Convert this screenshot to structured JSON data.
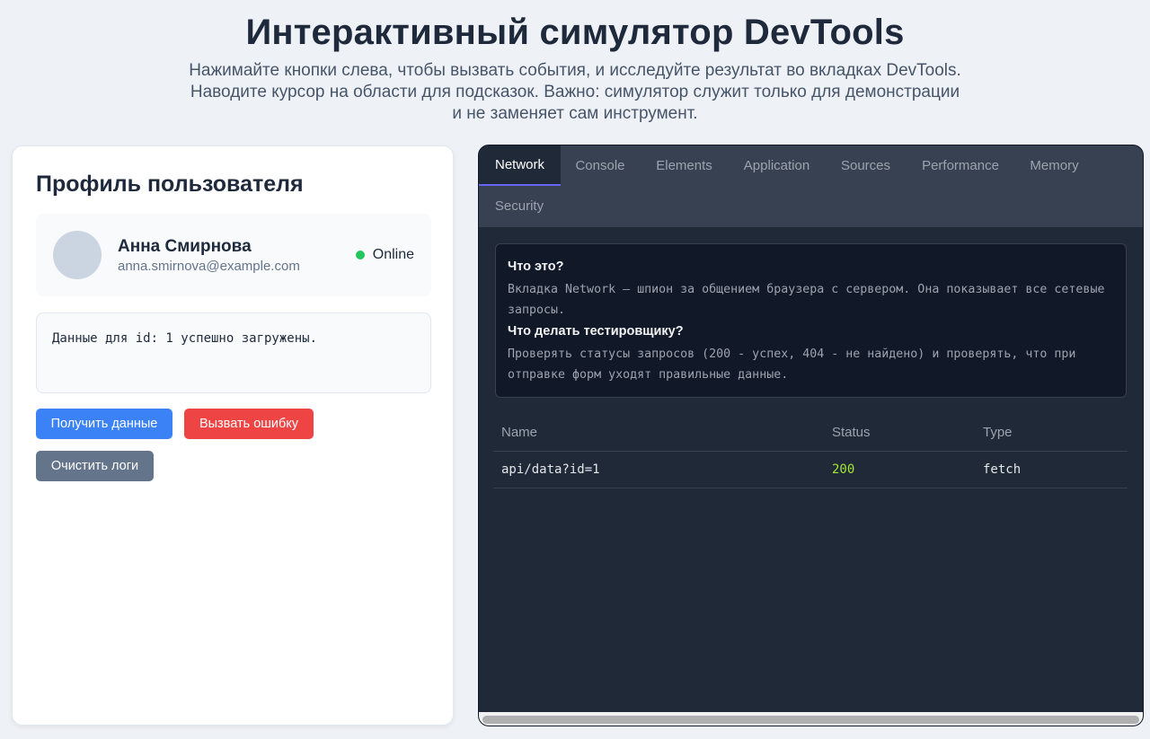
{
  "header": {
    "title": "Интерактивный симулятор DevTools",
    "subtitle": "Нажимайте кнопки слева, чтобы вызвать события, и исследуйте результат во вкладках DevTools. Наводите курсор на области для подсказок. Важно: симулятор служит только для демонстрации и не заменяет сам инструмент."
  },
  "profile_card": {
    "title": "Профиль пользователя",
    "user": {
      "name": "Анна Смирнова",
      "email": "anna.smirnova@example.com",
      "status": "Online"
    },
    "log_text": "Данные для id: 1 успешно загружены.",
    "buttons": {
      "fetch": "Получить данные",
      "error": "Вызвать ошибку",
      "clear": "Очистить логи"
    }
  },
  "devtools": {
    "active_tab": "Network",
    "tabs": [
      "Network",
      "Console",
      "Elements",
      "Application",
      "Sources",
      "Performance",
      "Memory",
      "Security"
    ],
    "info": {
      "q1": "Что это?",
      "a1": "Вкладка Network — шпион за общением браузера с сервером. Она показывает все сетевые запросы.",
      "q2": "Что делать тестировщику?",
      "a2": "Проверять статусы запросов (200 - успех, 404 - не найдено) и проверять, что при отправке форм уходят правильные данные."
    },
    "table": {
      "headers": [
        "Name",
        "Status",
        "Type"
      ],
      "rows": [
        [
          "api/data?id=1",
          "200",
          "fetch"
        ]
      ]
    }
  },
  "colors": {
    "accent_blue": "#3b82f6",
    "danger_red": "#ef4444",
    "neutral_gray": "#64748b",
    "online_green": "#22c55e",
    "status_ok": "#a3e635",
    "active_tab_underline": "#6366f1"
  },
  "icons": {
    "status_indicator": "status-dot-icon",
    "avatar": "avatar-placeholder"
  }
}
